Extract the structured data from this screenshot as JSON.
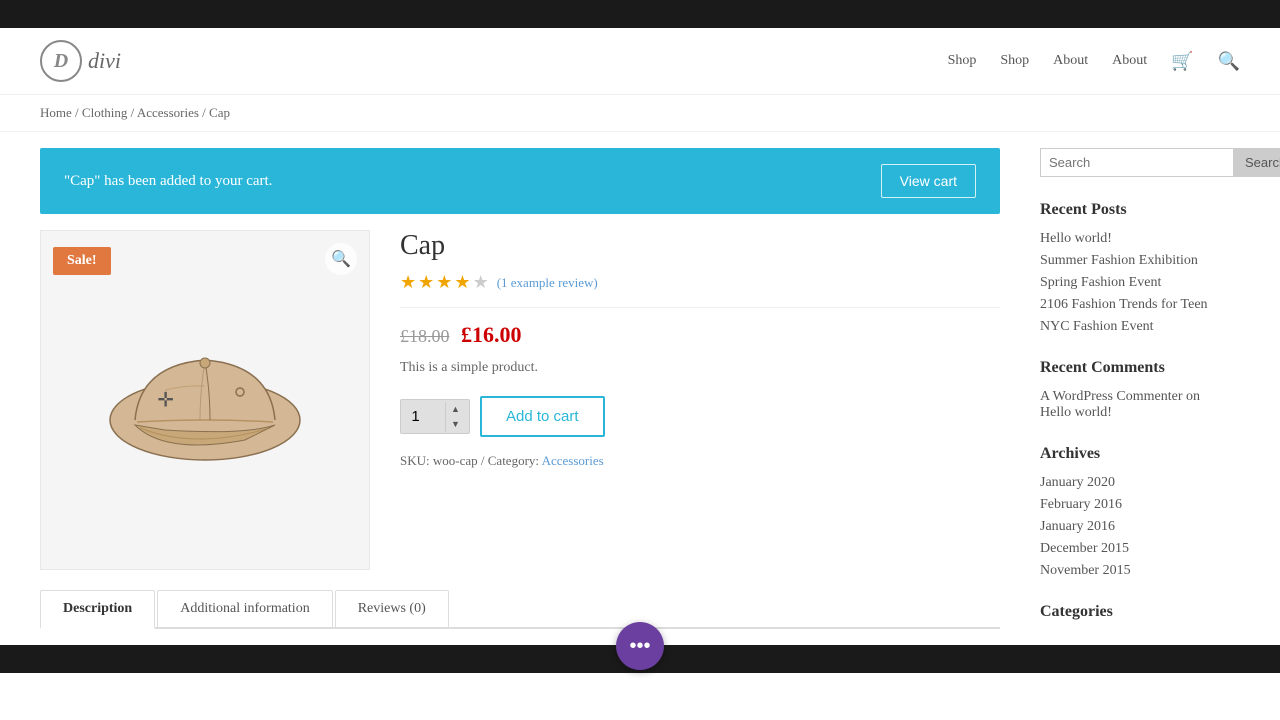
{
  "topbar": {},
  "header": {
    "logo_letter": "D",
    "logo_text": "divi",
    "nav": {
      "items": [
        {
          "label": "Shop",
          "href": "#"
        },
        {
          "label": "Shop",
          "href": "#"
        },
        {
          "label": "About",
          "href": "#"
        },
        {
          "label": "About",
          "href": "#"
        }
      ],
      "cart_icon": "🛒",
      "search_icon": "🔍"
    }
  },
  "breadcrumb": {
    "home": "Home",
    "clothing": "Clothing",
    "accessories": "Accessories",
    "current": "Cap",
    "separator": " / "
  },
  "notification": {
    "message": "\"Cap\" has been added to your cart.",
    "button_label": "View cart"
  },
  "product": {
    "title": "Cap",
    "sale_badge": "Sale!",
    "rating_count": 4,
    "rating_total": 5,
    "review_text": "(1 example review)",
    "original_price": "£18.00",
    "sale_price": "£16.00",
    "description": "This is a simple product.",
    "quantity_value": "1",
    "add_to_cart_label": "Add to cart",
    "sku": "woo-cap",
    "category_label": "Category:",
    "sku_label": "SKU:",
    "category": "Accessories"
  },
  "tabs": {
    "items": [
      {
        "label": "Description",
        "active": true
      },
      {
        "label": "Additional information",
        "active": false
      },
      {
        "label": "Reviews (0)",
        "active": false
      }
    ]
  },
  "sidebar": {
    "search_placeholder": "Search",
    "search_button": "Search",
    "recent_posts_title": "Recent Posts",
    "recent_posts": [
      {
        "label": "Hello world!"
      },
      {
        "label": "Summer Fashion Exhibition"
      },
      {
        "label": "Spring Fashion Event"
      },
      {
        "label": "2106 Fashion Trends for Teen"
      },
      {
        "label": "NYC Fashion Event"
      }
    ],
    "recent_comments_title": "Recent Comments",
    "recent_comment_author": "A WordPress Commenter on",
    "recent_comment_post": "Hello world!",
    "archives_title": "Archives",
    "archives": [
      {
        "label": "January 2020"
      },
      {
        "label": "February 2016"
      },
      {
        "label": "January 2016"
      },
      {
        "label": "December 2015"
      },
      {
        "label": "November 2015"
      }
    ],
    "categories_title": "Categories"
  },
  "floating_button": "•••"
}
